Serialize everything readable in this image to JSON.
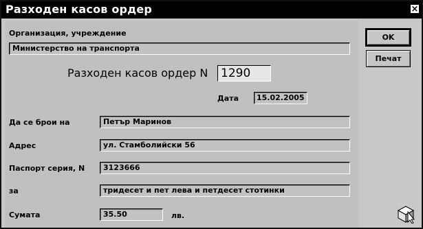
{
  "window": {
    "title": "Разходен касов ордер",
    "close_glyph": "×"
  },
  "form": {
    "organization_label": "Организация, учреждение",
    "organization_value": "Министерство на транспорта",
    "order_heading": "Разходен касов ордер N",
    "order_number": "1290",
    "date_label": "Дата",
    "date_value": "15.02.2005",
    "payee_label": "Да се брои на",
    "payee_value": "Петър Маринов",
    "address_label": "Адрес",
    "address_value": "ул. Стамболийски 56",
    "passport_label": "Паспорт серия, N",
    "passport_value": "3123666",
    "purpose_label": "за",
    "purpose_value": "тридесет и пет лева и петдесет стотинки",
    "amount_label": "Сумата",
    "amount_value": "35.50",
    "currency_label": "лв."
  },
  "buttons": {
    "ok_label": "OK",
    "print_label": "Печат"
  },
  "icons": {
    "corner": "cursor-cube-icon"
  }
}
